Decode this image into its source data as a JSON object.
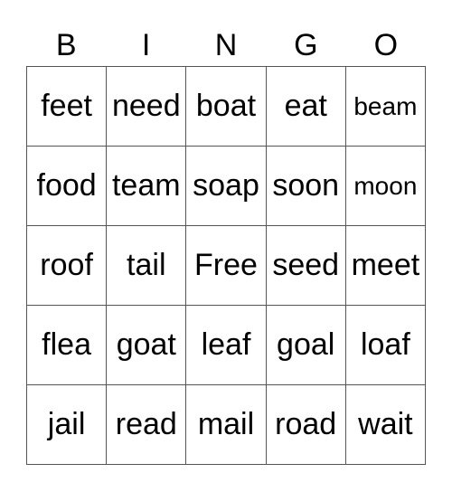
{
  "header": [
    "B",
    "I",
    "N",
    "G",
    "O"
  ],
  "rows": [
    [
      "feet",
      "need",
      "boat",
      "eat",
      "beam"
    ],
    [
      "food",
      "team",
      "soap",
      "soon",
      "moon"
    ],
    [
      "roof",
      "tail",
      "Free",
      "seed",
      "meet"
    ],
    [
      "flea",
      "goat",
      "leaf",
      "goal",
      "loaf"
    ],
    [
      "jail",
      "read",
      "mail",
      "road",
      "wait"
    ]
  ],
  "free_space_label": "Free"
}
